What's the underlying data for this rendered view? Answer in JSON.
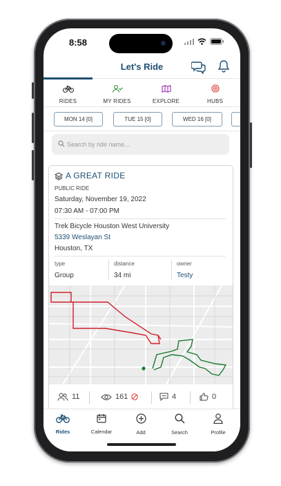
{
  "status": {
    "time": "8:58"
  },
  "header": {
    "title": "Let's Ride"
  },
  "tabs": [
    {
      "label": "RIDES",
      "icon": "bike-icon"
    },
    {
      "label": "MY RIDES",
      "icon": "user-check-icon"
    },
    {
      "label": "EXPLORE",
      "icon": "map-icon"
    },
    {
      "label": "HUBS",
      "icon": "target-icon"
    }
  ],
  "dates": [
    {
      "label": "MON 14 [0]"
    },
    {
      "label": "TUE 15 [0]"
    },
    {
      "label": "WED 16 [0]"
    }
  ],
  "search": {
    "placeholder": "Search by ride name..."
  },
  "ride": {
    "name": "A GREAT RIDE",
    "visibility": "PUBLIC RIDE",
    "date": "Saturday, November 19, 2022",
    "time": "07:30 AM - 07:00 PM",
    "location_name": "Trek Bicycle Houston West University",
    "address": "5339 Weslayan St",
    "city": "Houston, TX",
    "type_label": "type",
    "type_value": "Group",
    "distance_label": "distance",
    "distance_value": "34 mi",
    "owner_label": "owner",
    "owner_value": "Testy",
    "stats": {
      "riders": "11",
      "views": "161",
      "comments": "4",
      "likes": "0"
    }
  },
  "bottom_nav": [
    {
      "label": "Rides",
      "icon": "bike-icon"
    },
    {
      "label": "Calendar",
      "icon": "calendar-icon"
    },
    {
      "label": "Add",
      "icon": "plus-circle-icon"
    },
    {
      "label": "Search",
      "icon": "search-icon"
    },
    {
      "label": "Profile",
      "icon": "person-icon"
    }
  ],
  "colors": {
    "primary": "#1d4f73",
    "route_red": "#d0202a",
    "route_green": "#1a7a2e",
    "explore_purple": "#9a2fb0",
    "hubs_red": "#d9302c",
    "my_rides_green": "#2f8f3e"
  }
}
